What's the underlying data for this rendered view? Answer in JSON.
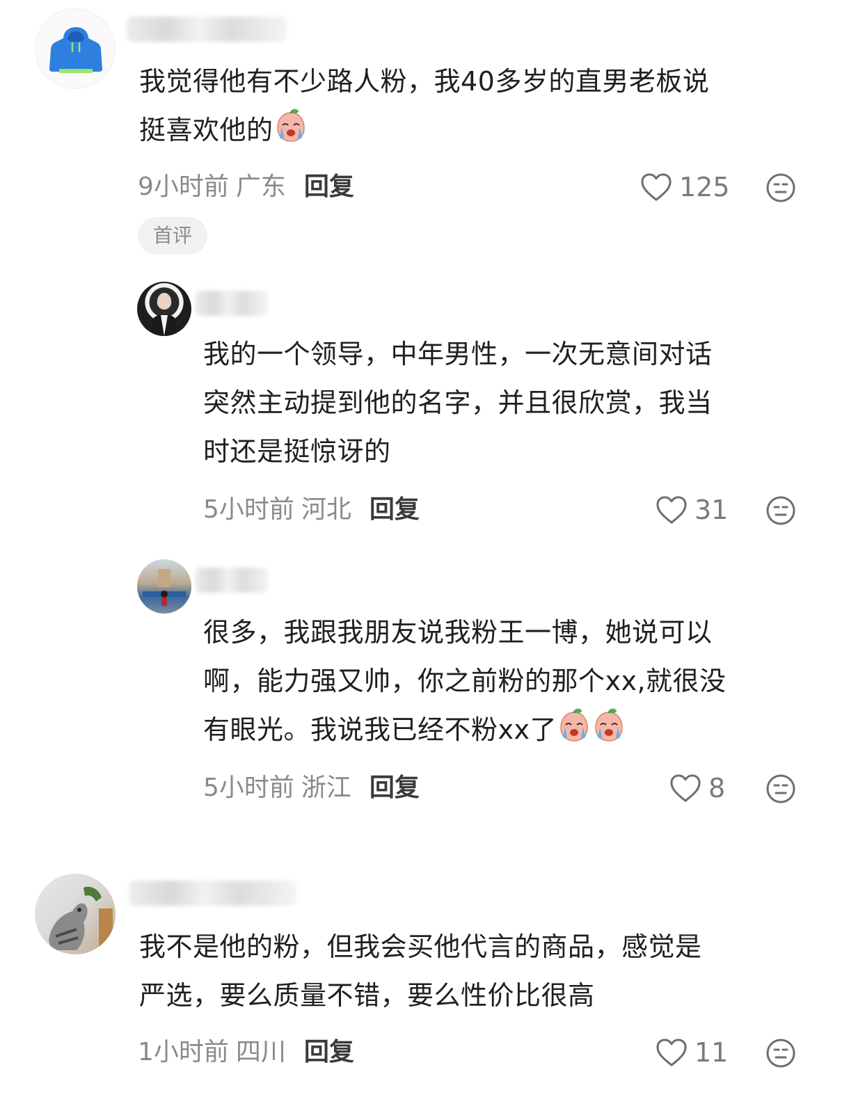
{
  "comments": [
    {
      "text_lines": [
        "我觉得他有不少路人粉，我40多岁的直男老板说",
        "挺喜欢他的"
      ],
      "time": "9小时前",
      "location": "广东",
      "reply_label": "回复",
      "likes": "125",
      "badge": "首评",
      "avatar_icon": "hoodie-icon",
      "inline_emoji": "crying-face-emoji"
    },
    {
      "text_lines": [
        "我的一个领导，中年男性，一次无意间对话",
        "突然主动提到他的名字，并且很欣赏，我当",
        "时还是挺惊讶的"
      ],
      "time": "5小时前",
      "location": "河北",
      "reply_label": "回复",
      "likes": "31"
    },
    {
      "text_lines": [
        "很多，我跟我朋友说我粉王一博，她说可以",
        "啊，能力强又帅，你之前粉的那个xx,就很没",
        "有眼光。我说我已经不粉xx了"
      ],
      "time": "5小时前",
      "location": "浙江",
      "reply_label": "回复",
      "likes": "8",
      "inline_emoji": "crying-face-emoji"
    },
    {
      "text_lines": [
        "我不是他的粉，但我会买他代言的商品，感觉是",
        "严选，要么质量不错，要么性价比很高"
      ],
      "time": "1小时前",
      "location": "四川",
      "reply_label": "回复",
      "likes": "11"
    }
  ],
  "colors": {
    "text": "#1f1f1f",
    "meta": "#8a8a8a",
    "badge_bg": "#f1f1f1",
    "hoodie": "#2f7fe0"
  }
}
